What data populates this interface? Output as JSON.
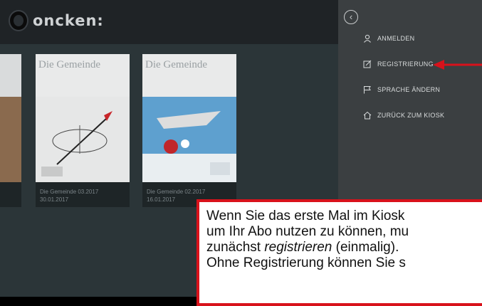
{
  "header": {
    "logo_text": "oncken:"
  },
  "kiosk": {
    "covers": [
      {
        "title": "Die Gemeinde",
        "caption_line1": "Die Gemeinde 03.2017",
        "caption_line2": "30.01.2017"
      },
      {
        "title": "Die Gemeinde",
        "caption_line1": "Die Gemeinde 02.2017",
        "caption_line2": "16.01.2017"
      }
    ]
  },
  "menu": {
    "back_icon": "chevron-left-circle-icon",
    "items": [
      {
        "label": "ANMELDEN",
        "icon": "user-icon"
      },
      {
        "label": "REGISTRIERUNG",
        "icon": "edit-icon"
      },
      {
        "label": "SPRACHE ÄNDERN",
        "icon": "flag-icon"
      },
      {
        "label": "ZURÜCK ZUM KIOSK",
        "icon": "home-icon"
      }
    ]
  },
  "annotation": {
    "line1": "Wenn Sie das erste Mal im Kiosk",
    "line2": "um Ihr Abo nutzen zu können, mu",
    "line3_pre": "zunächst ",
    "line3_em": "registrieren",
    "line3_post": " (einmalig).",
    "line4": "Ohne Registrierung können Sie s"
  },
  "colors": {
    "accent_red": "#d8121b",
    "menu_bg": "#3b3f41",
    "kiosk_bg": "#2b3538"
  }
}
